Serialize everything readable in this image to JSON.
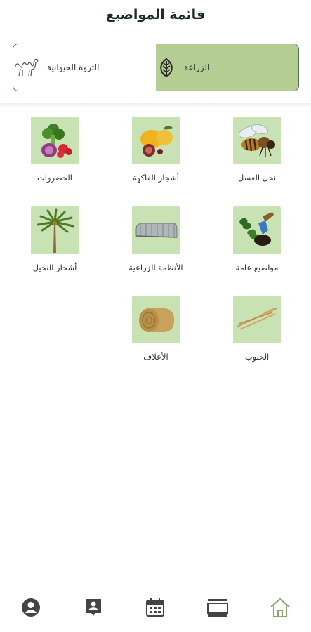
{
  "header": {
    "title": "قائمة المواضيع"
  },
  "tabs": [
    {
      "label": "الزراعة",
      "icon": "leaf-icon",
      "active": true
    },
    {
      "label": "الثروة الحيوانية",
      "icon": "camel-icon",
      "active": false
    }
  ],
  "topics": [
    {
      "label": "نحل العسل",
      "icon": "bee-icon"
    },
    {
      "label": "أشجار الفاكهة",
      "icon": "fruit-icon"
    },
    {
      "label": "الخضروات",
      "icon": "vegetables-icon"
    },
    {
      "label": "مواضيع عامة",
      "icon": "gardening-tools-icon"
    },
    {
      "label": "الأنظمة الزراعية",
      "icon": "greenhouse-icon"
    },
    {
      "label": "أشجار النخيل",
      "icon": "palm-tree-icon"
    },
    {
      "label": "الحبوب",
      "icon": "wheat-icon"
    },
    {
      "label": "الأعلاف",
      "icon": "hay-bale-icon"
    }
  ],
  "bottom_nav": [
    {
      "icon": "profile-icon",
      "active": false
    },
    {
      "icon": "contact-card-icon",
      "active": false
    },
    {
      "icon": "calendar-icon",
      "active": false
    },
    {
      "icon": "layers-icon",
      "active": false
    },
    {
      "icon": "home-icon",
      "active": true
    }
  ],
  "colors": {
    "accent": "#b3cd93",
    "tile_bg": "#c9e2b3",
    "border": "#556b55",
    "nav_icon": "#444444",
    "nav_active": "#8aa56b"
  }
}
